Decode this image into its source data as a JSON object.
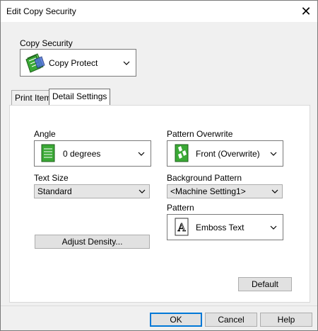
{
  "window": {
    "title": "Edit Copy Security",
    "close_glyph": "✕"
  },
  "copy_security": {
    "label": "Copy Security",
    "underline_char": "y",
    "value": "Copy Protect"
  },
  "tabs": [
    {
      "label": "Print Item",
      "selected": false
    },
    {
      "label": "Detail Settings",
      "selected": true
    }
  ],
  "angle": {
    "label": "Angle",
    "value": "0 degrees"
  },
  "text_size": {
    "label": "Text Size",
    "value": "Standard"
  },
  "pattern_overwrite": {
    "label": "Pattern Overwrite",
    "value": "Front (Overwrite)"
  },
  "background_pattern": {
    "label": "Background Pattern",
    "value": "<Machine Setting1>"
  },
  "pattern": {
    "label": "Pattern",
    "value": "Emboss Text"
  },
  "buttons": {
    "adjust_density": "Adjust Density...",
    "default": "Default",
    "ok": "OK",
    "cancel": "Cancel",
    "help": "Help"
  },
  "colors": {
    "accent_green": "#3aa935",
    "focus_blue": "#0078d7"
  },
  "icons": [
    "copy-protect-icon",
    "angle-icon",
    "pattern-overwrite-icon",
    "emboss-text-icon",
    "chevron-down-icon",
    "close-icon"
  ]
}
